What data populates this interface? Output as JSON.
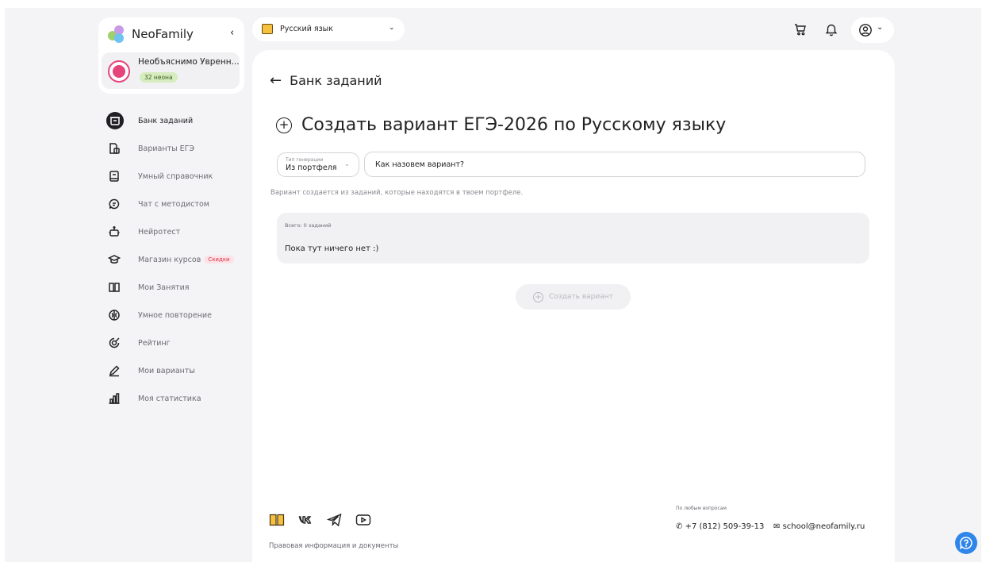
{
  "colors": {
    "page_bg": "#f4f4f6",
    "card_bg": "#ffffff",
    "text_primary": "#1f1f24",
    "text_muted": "#8a8a92",
    "neon_badge_bg": "#d7ecbf",
    "sale_badge_bg": "#fde2e6",
    "avatar_accent": "#e5457a",
    "help_button": "#2e86ea"
  },
  "sidebar": {
    "app_name": "NeoFamily",
    "user": {
      "name": "Необъяснимо Увренн...",
      "neons": "32 неона"
    },
    "items": [
      {
        "label": "Банк заданий",
        "icon": "archive-icon",
        "active": true
      },
      {
        "label": "Варианты ЕГЭ",
        "icon": "documents-icon"
      },
      {
        "label": "Умный справочник",
        "icon": "book-icon"
      },
      {
        "label": "Чат с методистом",
        "icon": "chat-icon"
      },
      {
        "label": "Нейротест",
        "icon": "robot-icon"
      },
      {
        "label": "Магазин курсов",
        "icon": "graduation-cap-icon",
        "badge": "Скидки"
      },
      {
        "label": "Мои Занятия",
        "icon": "open-book-icon"
      },
      {
        "label": "Умное повторение",
        "icon": "brain-icon"
      },
      {
        "label": "Рейтинг",
        "icon": "target-icon"
      },
      {
        "label": "Мои варианты",
        "icon": "pencil-icon"
      },
      {
        "label": "Моя статистика",
        "icon": "bar-chart-icon"
      }
    ]
  },
  "header": {
    "subject": "Русский язык"
  },
  "main": {
    "back_label": "Банк заданий",
    "title": "Создать вариант ЕГЭ-2026 по Русскому языку",
    "generation_type": {
      "label": "Тип генерации",
      "value": "Из портфеля"
    },
    "variant_name_placeholder": "Как назовем вариант?",
    "hint": "Вариант создается из заданий, которые находятся в твоем портфеле.",
    "tasks": {
      "total": "Всего: 0 заданий",
      "empty": "Пока тут ничего нет :)"
    },
    "create_button": "Создать вариант"
  },
  "footer": {
    "legal": "Правовая информация и документы",
    "any_questions": "По любым вопросам",
    "phone": "+7 (812) 509-39-13",
    "email": "school@neofamily.ru"
  }
}
